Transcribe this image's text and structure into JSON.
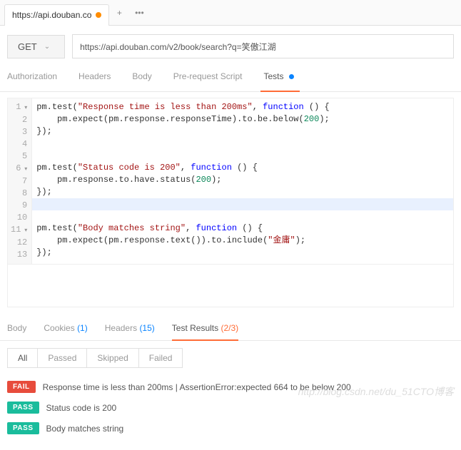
{
  "tab": {
    "title": "https://api.douban.co"
  },
  "request": {
    "method": "GET",
    "url": "https://api.douban.com/v2/book/search?q=笑傲江湖"
  },
  "req_tabs": {
    "authorization": "Authorization",
    "headers": "Headers",
    "body": "Body",
    "prerequest": "Pre-request Script",
    "tests": "Tests"
  },
  "code": {
    "l1a": "pm.test(",
    "l1s": "\"Response time is less than 200ms\"",
    "l1b": ", ",
    "l1k": "function",
    "l1c": " () {",
    "l2a": "    pm.expect(pm.response.responseTime).to.be.below(",
    "l2n": "200",
    "l2b": ");",
    "l3": "});",
    "l6a": "pm.test(",
    "l6s": "\"Status code is 200\"",
    "l6b": ", ",
    "l6k": "function",
    "l6c": " () {",
    "l7a": "    pm.response.to.have.status(",
    "l7n": "200",
    "l7b": ");",
    "l8": "});",
    "l11a": "pm.test(",
    "l11s": "\"Body matches string\"",
    "l11b": ", ",
    "l11k": "function",
    "l11c": " () {",
    "l12a": "    pm.expect(pm.response.text()).to.include(",
    "l12s": "\"金庸\"",
    "l12b": ");",
    "l13": "});"
  },
  "resp_tabs": {
    "body": "Body",
    "cookies": "Cookies",
    "cookies_count": "(1)",
    "headers": "Headers",
    "headers_count": "(15)",
    "test_results": "Test Results",
    "test_results_count": "(2/3)"
  },
  "filters": {
    "all": "All",
    "passed": "Passed",
    "skipped": "Skipped",
    "failed": "Failed"
  },
  "results": [
    {
      "status": "FAIL",
      "text": "Response time is less than 200ms | AssertionError:expected 664 to be below 200"
    },
    {
      "status": "PASS",
      "text": "Status code is 200"
    },
    {
      "status": "PASS",
      "text": "Body matches string"
    }
  ],
  "watermark": "http://blog.csdn.net/du_51CTO博客"
}
